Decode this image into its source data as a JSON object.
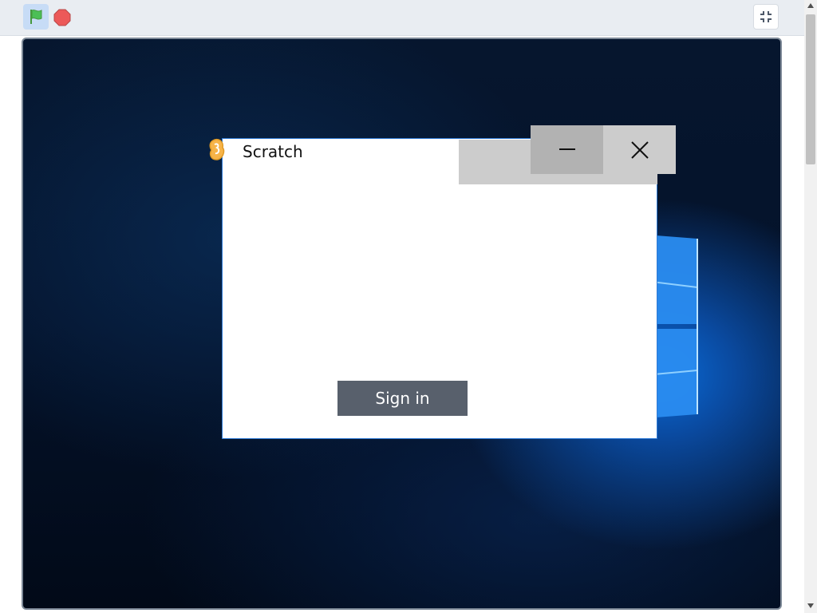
{
  "toolbar": {
    "green_flag_icon": "green-flag-icon",
    "stop_icon": "stop-icon",
    "fullscreen_icon": "exit-fullscreen-icon",
    "colors": {
      "flag": "#4cbf56",
      "stop": "#ec5959",
      "flag_bg": "#c7dcf6"
    }
  },
  "stage": {
    "dialog": {
      "title": "Scratch",
      "app_icon": "scratch-cat-icon",
      "minimize_icon": "minimize-icon",
      "close_icon": "close-icon",
      "signin_label": "Sign in",
      "colors": {
        "border": "#2f7bd6",
        "button": "#58606c"
      }
    },
    "background_logo": "windows-logo-icon"
  },
  "scrollbar": {
    "up_icon": "scroll-up-arrow-icon",
    "down_icon": "scroll-down-arrow-icon"
  }
}
